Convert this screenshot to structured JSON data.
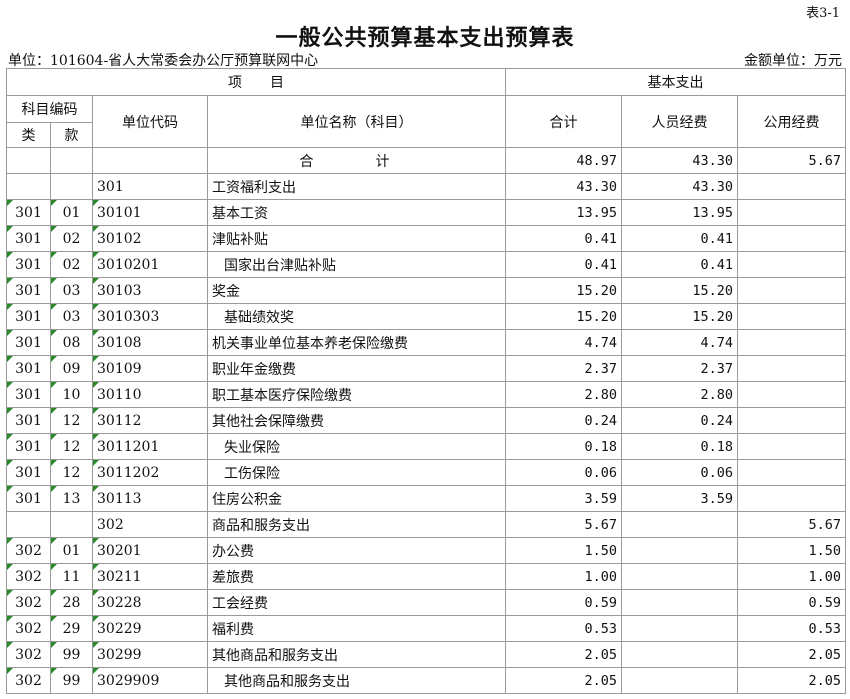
{
  "header": {
    "table_no": "表3-1",
    "title": "一般公共预算基本支出预算表",
    "unit": "单位：101604-省人大常委会办公厅预算联网中心",
    "amount_unit": "金额单位：万元"
  },
  "columns": {
    "project": "项　　目",
    "basic_expense": "基本支出",
    "subject_code": "科目编码",
    "lei": "类",
    "kuan": "款",
    "unit_code": "单位代码",
    "unit_name": "单位名称（科目）",
    "total": "合计",
    "personnel": "人员经费",
    "public": "公用经费"
  },
  "rows": [
    {
      "lei": "",
      "kuan": "",
      "code": "",
      "name": "合　计",
      "total": "48.97",
      "personnel": "43.30",
      "public": "5.67",
      "type": "total",
      "indent": false,
      "marked": false
    },
    {
      "lei": "",
      "kuan": "",
      "code": "301",
      "name": "工资福利支出",
      "total": "43.30",
      "personnel": "43.30",
      "public": "",
      "type": "group",
      "indent": false,
      "marked": false
    },
    {
      "lei": "301",
      "kuan": "01",
      "code": "30101",
      "name": "基本工资",
      "total": "13.95",
      "personnel": "13.95",
      "public": "",
      "type": "item",
      "indent": false,
      "marked": true
    },
    {
      "lei": "301",
      "kuan": "02",
      "code": "30102",
      "name": "津贴补贴",
      "total": "0.41",
      "personnel": "0.41",
      "public": "",
      "type": "item",
      "indent": false,
      "marked": true
    },
    {
      "lei": "301",
      "kuan": "02",
      "code": "3010201",
      "name": "国家出台津贴补贴",
      "total": "0.41",
      "personnel": "0.41",
      "public": "",
      "type": "item",
      "indent": true,
      "marked": true
    },
    {
      "lei": "301",
      "kuan": "03",
      "code": "30103",
      "name": "奖金",
      "total": "15.20",
      "personnel": "15.20",
      "public": "",
      "type": "item",
      "indent": false,
      "marked": true
    },
    {
      "lei": "301",
      "kuan": "03",
      "code": "3010303",
      "name": "基础绩效奖",
      "total": "15.20",
      "personnel": "15.20",
      "public": "",
      "type": "item",
      "indent": true,
      "marked": true
    },
    {
      "lei": "301",
      "kuan": "08",
      "code": "30108",
      "name": "机关事业单位基本养老保险缴费",
      "total": "4.74",
      "personnel": "4.74",
      "public": "",
      "type": "item",
      "indent": false,
      "marked": true
    },
    {
      "lei": "301",
      "kuan": "09",
      "code": "30109",
      "name": "职业年金缴费",
      "total": "2.37",
      "personnel": "2.37",
      "public": "",
      "type": "item",
      "indent": false,
      "marked": true
    },
    {
      "lei": "301",
      "kuan": "10",
      "code": "30110",
      "name": "职工基本医疗保险缴费",
      "total": "2.80",
      "personnel": "2.80",
      "public": "",
      "type": "item",
      "indent": false,
      "marked": true
    },
    {
      "lei": "301",
      "kuan": "12",
      "code": "30112",
      "name": "其他社会保障缴费",
      "total": "0.24",
      "personnel": "0.24",
      "public": "",
      "type": "item",
      "indent": false,
      "marked": true
    },
    {
      "lei": "301",
      "kuan": "12",
      "code": "3011201",
      "name": "失业保险",
      "total": "0.18",
      "personnel": "0.18",
      "public": "",
      "type": "item",
      "indent": true,
      "marked": true
    },
    {
      "lei": "301",
      "kuan": "12",
      "code": "3011202",
      "name": "工伤保险",
      "total": "0.06",
      "personnel": "0.06",
      "public": "",
      "type": "item",
      "indent": true,
      "marked": true
    },
    {
      "lei": "301",
      "kuan": "13",
      "code": "30113",
      "name": "住房公积金",
      "total": "3.59",
      "personnel": "3.59",
      "public": "",
      "type": "item",
      "indent": false,
      "marked": true
    },
    {
      "lei": "",
      "kuan": "",
      "code": "302",
      "name": "商品和服务支出",
      "total": "5.67",
      "personnel": "",
      "public": "5.67",
      "type": "group",
      "indent": false,
      "marked": false
    },
    {
      "lei": "302",
      "kuan": "01",
      "code": "30201",
      "name": "办公费",
      "total": "1.50",
      "personnel": "",
      "public": "1.50",
      "type": "item",
      "indent": false,
      "marked": true
    },
    {
      "lei": "302",
      "kuan": "11",
      "code": "30211",
      "name": "差旅费",
      "total": "1.00",
      "personnel": "",
      "public": "1.00",
      "type": "item",
      "indent": false,
      "marked": true
    },
    {
      "lei": "302",
      "kuan": "28",
      "code": "30228",
      "name": "工会经费",
      "total": "0.59",
      "personnel": "",
      "public": "0.59",
      "type": "item",
      "indent": false,
      "marked": true
    },
    {
      "lei": "302",
      "kuan": "29",
      "code": "30229",
      "name": "福利费",
      "total": "0.53",
      "personnel": "",
      "public": "0.53",
      "type": "item",
      "indent": false,
      "marked": true
    },
    {
      "lei": "302",
      "kuan": "99",
      "code": "30299",
      "name": "其他商品和服务支出",
      "total": "2.05",
      "personnel": "",
      "public": "2.05",
      "type": "item",
      "indent": false,
      "marked": true
    },
    {
      "lei": "302",
      "kuan": "99",
      "code": "3029909",
      "name": "其他商品和服务支出",
      "total": "2.05",
      "personnel": "",
      "public": "2.05",
      "type": "item",
      "indent": true,
      "marked": true
    }
  ],
  "colors": {
    "border": "#9a9a9a",
    "marker": "#2a8a2a"
  }
}
